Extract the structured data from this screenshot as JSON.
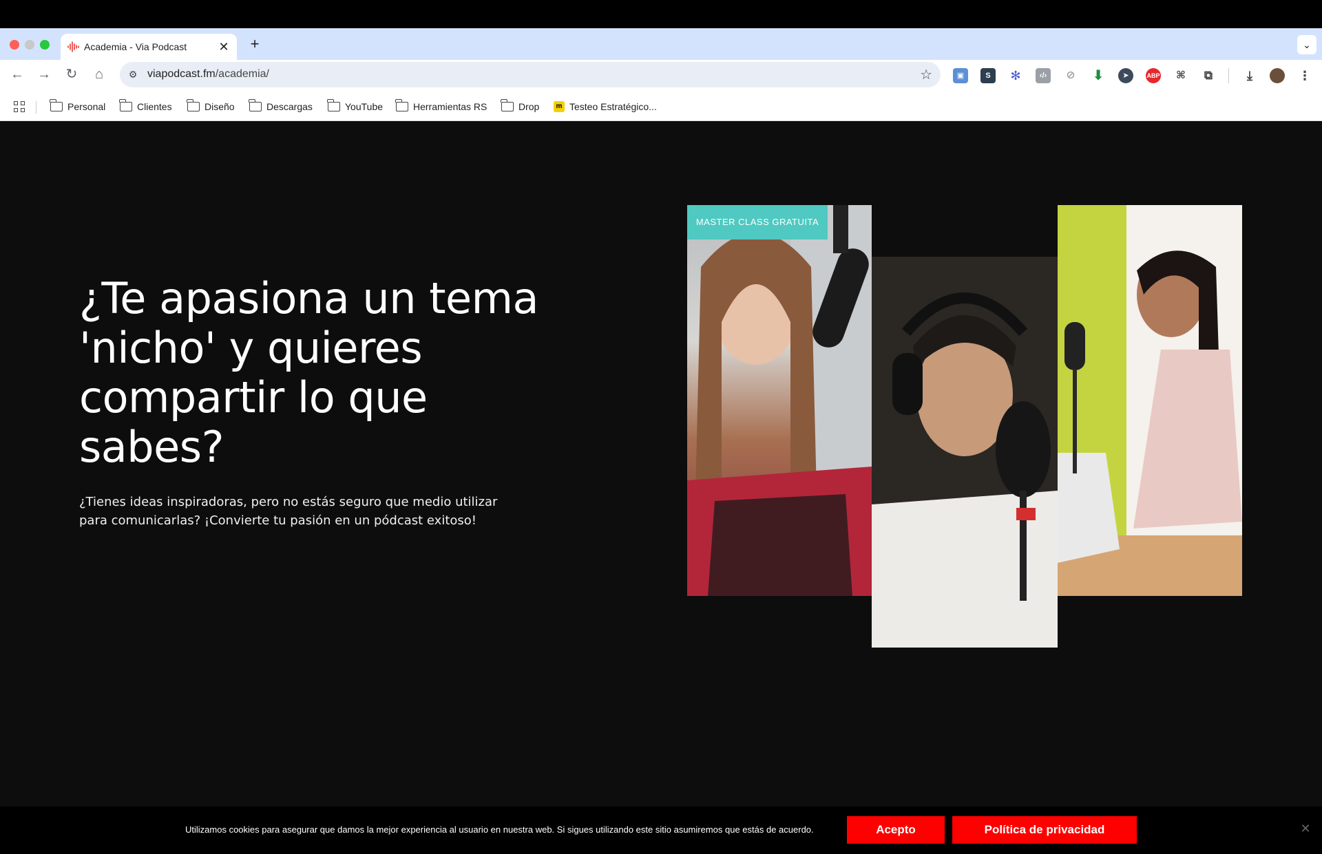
{
  "browser": {
    "tab_title": "Academia - Via Podcast",
    "tab_close": "✕",
    "new_tab": "+",
    "tab_search": "⌄",
    "url_domain": "viapodcast.fm",
    "url_path": "/academia/",
    "bookmarks": [
      "Personal",
      "Clientes",
      "Diseño",
      "Descargas",
      "YouTube",
      "Herramientas RS",
      "Drop",
      "Testeo Estratégico..."
    ]
  },
  "hero": {
    "headline": "¿Te apasiona un tema 'nicho' y quieres compartir lo que sabes?",
    "subtext": "¿Tienes ideas inspiradoras, pero no estás seguro que medio utilizar para comunicarlas? ¡Convierte tu pasión en un pódcast exitoso!",
    "badge": "MASTER CLASS GRATUITA"
  },
  "cookie_bar": {
    "text": "Utilizamos cookies para asegurar que damos la mejor experiencia al usuario en nuestra web. Si sigues utilizando este sitio asumiremos que estás de acuerdo.",
    "accept_label": "Acepto",
    "policy_label": "Política de privacidad",
    "close": "✕"
  },
  "colors": {
    "accent": "#4fc9c1",
    "cookie_button": "#ff0000",
    "page_bg": "#0d0d0d"
  }
}
